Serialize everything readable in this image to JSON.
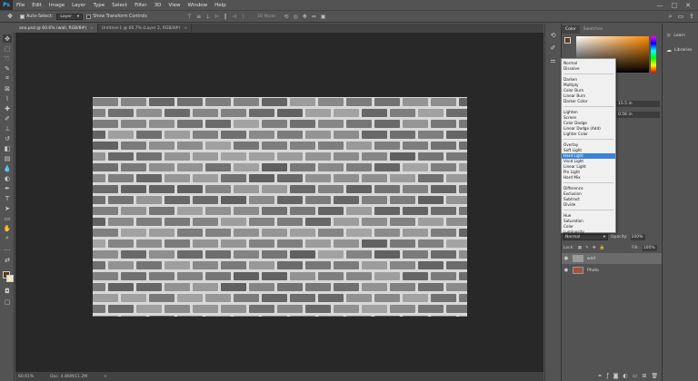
{
  "app": {
    "logo": "Ps",
    "menu": [
      "File",
      "Edit",
      "Image",
      "Layer",
      "Type",
      "Select",
      "Filter",
      "3D",
      "View",
      "Window",
      "Help"
    ],
    "window_controls": [
      "—",
      "□",
      "✕"
    ]
  },
  "options_bar": {
    "auto_select_label": "Auto-Select:",
    "auto_select_target": "Layer",
    "transform_label": "Show Transform Controls",
    "mode_3d_label": "3D Mode:"
  },
  "tabs": [
    {
      "label": "ana.psd @ 60.6% (wall, RGB/8#)",
      "close": "×",
      "active": true
    },
    {
      "label": "Untitled-1 @ 66.7% (Layer 2, RGB/8#)",
      "close": "×",
      "active": false
    }
  ],
  "status": {
    "zoom": "60.61%",
    "doc": "Doc: 4.86M/11.2M",
    "arrow": ">"
  },
  "color_panel": {
    "tabs": [
      "Color",
      "Swatches"
    ],
    "fg_color": "#5a3d1a",
    "bg_color": "#f5e5c0"
  },
  "properties_fields": [
    "15.5 in",
    "0.56 in"
  ],
  "layers": {
    "blend_mode": "Normal",
    "opacity_label": "Opacity:",
    "opacity_value": "100%",
    "lock_label": "Lock:",
    "fill_label": "Fill:",
    "fill_value": "100%",
    "items": [
      {
        "name": "wall",
        "visible": true,
        "selected": true,
        "thumb": "wall"
      },
      {
        "name": "Photo",
        "visible": true,
        "selected": false,
        "thumb": "photo"
      }
    ]
  },
  "blend_modes": {
    "groups": [
      [
        "Normal",
        "Dissolve"
      ],
      [
        "Darken",
        "Multiply",
        "Color Burn",
        "Linear Burn",
        "Darker Color"
      ],
      [
        "Lighten",
        "Screen",
        "Color Dodge",
        "Linear Dodge (Add)",
        "Lighter Color"
      ],
      [
        "Overlay",
        "Soft Light",
        "Hard Light",
        "Vivid Light",
        "Linear Light",
        "Pin Light",
        "Hard Mix"
      ],
      [
        "Difference",
        "Exclusion",
        "Subtract",
        "Divide"
      ],
      [
        "Hue",
        "Saturation",
        "Color",
        "Luminosity"
      ]
    ],
    "highlighted": "Hard Light"
  },
  "far_right": {
    "learn": "Learn",
    "libraries": "Libraries"
  },
  "document": {
    "canvas_color": "#282828",
    "content": "brick wall"
  }
}
